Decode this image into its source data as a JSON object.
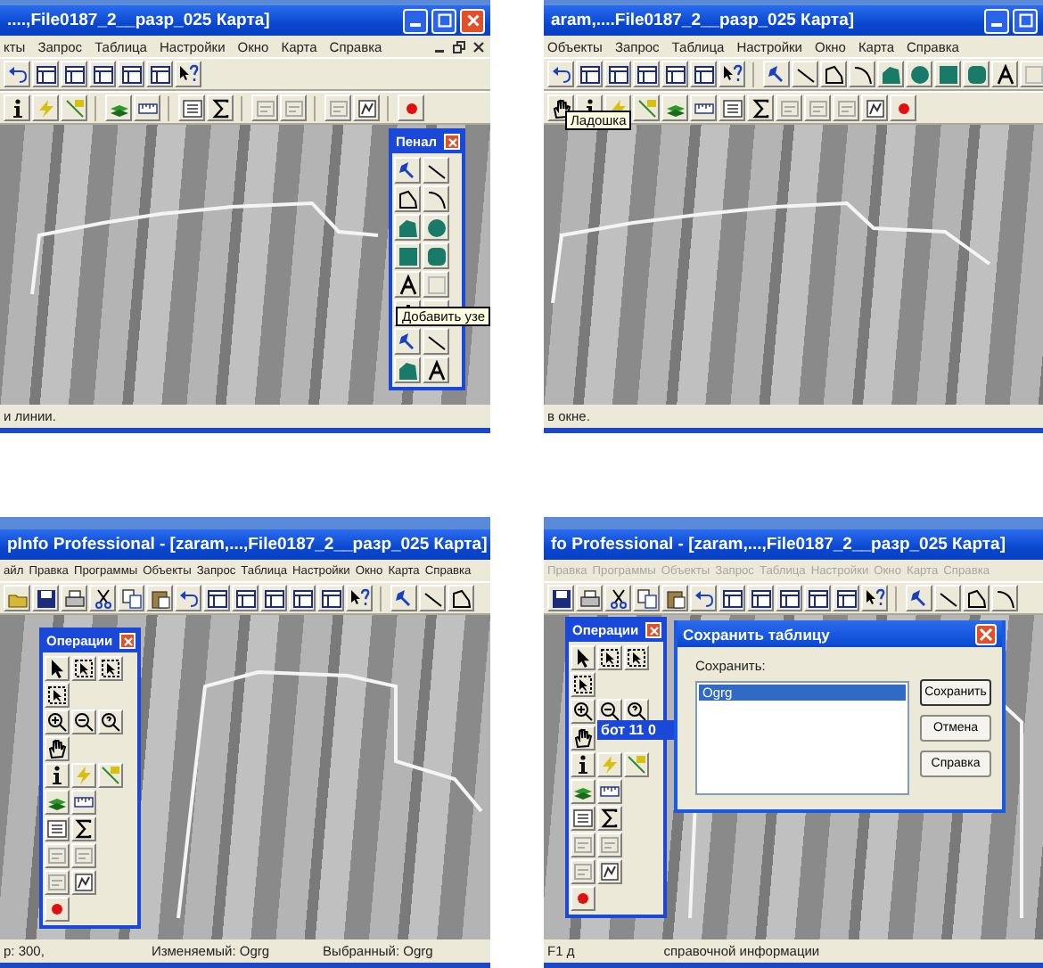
{
  "panels": [
    {
      "title": "....,File0187_2__разр_025 Карта]",
      "menu": {
        "disabled": false,
        "items": [
          "кты",
          "Запрос",
          "Таблица",
          "Настройки",
          "Окно",
          "Карта",
          "Справка"
        ]
      },
      "palette": {
        "kind": "drawing",
        "title": "Пенал"
      },
      "tooltip": "Добавить узе",
      "status": [
        "и линии."
      ]
    },
    {
      "title": "aram,....File0187_2__разр_025 Карта]",
      "menu": {
        "disabled": false,
        "items": [
          "Объекты",
          "Запрос",
          "Таблица",
          "Настройки",
          "Окно",
          "Карта",
          "Справка"
        ]
      },
      "tooltip": "Ладошка",
      "status": [
        "в окне."
      ]
    },
    {
      "title": "pInfo Professional - [zaram,...,File0187_2__разр_025 Карта]",
      "menu": {
        "disabled": false,
        "items": [
          "айл",
          "Правка",
          "Программы",
          "Объекты",
          "Запрос",
          "Таблица",
          "Настройки",
          "Окно",
          "Карта",
          "Справка"
        ]
      },
      "palette": {
        "kind": "operations",
        "title": "Операции"
      },
      "status": [
        "р: 300,",
        "Изменяемый: Ogrg",
        "Выбранный: Ogrg"
      ]
    },
    {
      "title": "fo Professional - [zaram,...,File0187_2__разр_025 Карта]",
      "menu": {
        "disabled": true,
        "items": [
          "Правка",
          "Программы",
          "Объекты",
          "Запрос",
          "Таблица",
          "Настройки",
          "Окно",
          "Карта",
          "Справка"
        ]
      },
      "palette": {
        "kind": "operations",
        "title": "Операции"
      },
      "highlight": "бот 11 0",
      "dialog": {
        "title": "Сохранить таблицу",
        "label": "Сохранить:",
        "items": [
          {
            "label": "Ogrg",
            "selected": true
          }
        ],
        "buttons": [
          "Сохранить",
          "Отмена",
          "Справка"
        ]
      },
      "status": [
        "F1 д",
        "справочной информации"
      ]
    }
  ]
}
